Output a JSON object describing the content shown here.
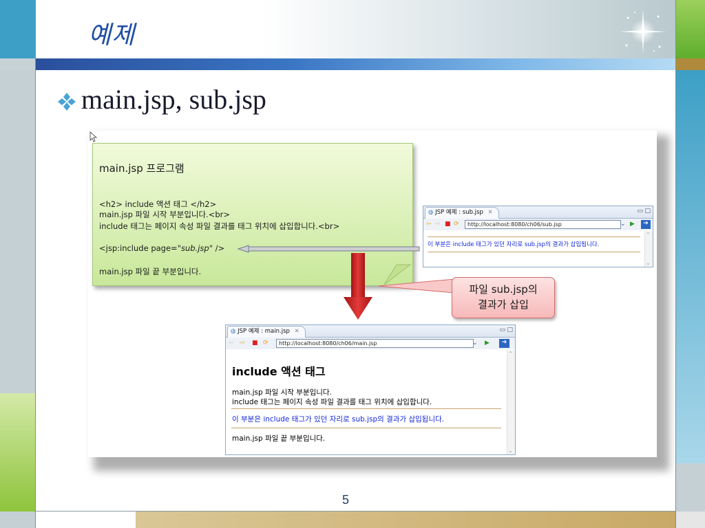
{
  "slide": {
    "title": "예제",
    "bullet_text": "main.jsp, sub.jsp",
    "page_number": "5",
    "colors": {
      "title": "#1f4fa3",
      "accent_blue": "#3d9fc6",
      "accent_green": "#8ec43c"
    }
  },
  "note": {
    "title": "main.jsp 프로그램",
    "code_lines": [
      "<h2> include 액션 태그 </h2>",
      "main.jsp 파일 시작 부분입니다.<br>",
      "include 태그는 페이지 속성 파일 결과를 태그 위치에 삽입합니다.<br>"
    ],
    "include_prefix": "<jsp:include page=",
    "include_value": "\"sub.jsp\"",
    "include_suffix": " />",
    "end_line": "main.jsp 파일 끝 부분입니다."
  },
  "callout": {
    "line1": "파일 sub.jsp의",
    "line2": "결과가 삽입"
  },
  "sub_window": {
    "tab_label": "JSP 예제 : sub.jsp",
    "url": "http://localhost:8080/ch06/sub.jsp",
    "content": "이 부분은 include 태그가 있던 자리로 sub.jsp의 결과가 삽입됩니다."
  },
  "main_window": {
    "tab_label": "JSP 예제 : main.jsp",
    "url": "http://localhost:8080/ch06/main.jsp",
    "heading": "include 액션 태그",
    "line1": "main.jsp 파일 시작 부분입니다.",
    "line2": "include 태그는 페이지 속성 파일 결과를 태그 위치에 삽입합니다.",
    "included": "이 부분은 include 태그가 있던 자리로 sub.jsp의 결과가 삽입됩니다.",
    "end_line": "main.jsp 파일 끝 부분입니다."
  },
  "icons": [
    "sparkle-icon",
    "diamond-bullet-icon",
    "cursor-icon",
    "globe-icon",
    "close-icon",
    "back-icon",
    "forward-icon",
    "stop-icon",
    "refresh-icon",
    "dropdown-icon",
    "go-icon",
    "minimize-icon",
    "maximize-icon",
    "scroll-up-icon",
    "scroll-down-icon",
    "arrow-left-icon",
    "arrow-down-icon"
  ]
}
